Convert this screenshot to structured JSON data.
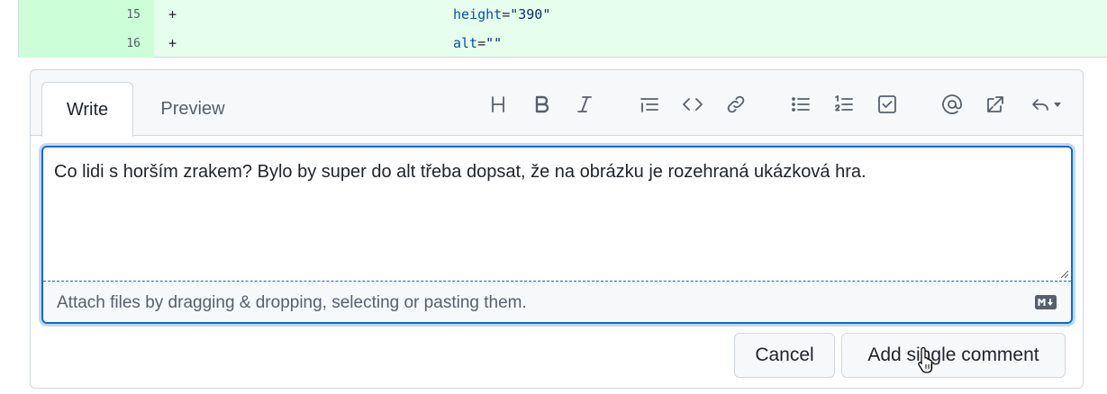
{
  "diff": {
    "lines": [
      {
        "number": "15",
        "sign": "+",
        "attr": "height",
        "eq": "=",
        "value": "\"390\""
      },
      {
        "number": "16",
        "sign": "+",
        "attr": "alt",
        "eq": "=",
        "value": "\"\""
      }
    ]
  },
  "comment": {
    "tabs": {
      "write": "Write",
      "preview": "Preview"
    },
    "toolbar": [
      {
        "icon": "heading-icon"
      },
      {
        "icon": "bold-icon"
      },
      {
        "icon": "italic-icon"
      },
      {
        "icon": "quote-icon"
      },
      {
        "icon": "code-icon"
      },
      {
        "icon": "link-icon"
      },
      {
        "icon": "bulleted-list-icon"
      },
      {
        "icon": "numbered-list-icon"
      },
      {
        "icon": "task-list-icon"
      },
      {
        "icon": "mention-icon"
      },
      {
        "icon": "cross-reference-icon"
      },
      {
        "icon": "reply-icon"
      }
    ],
    "text": "Co lidi s horším zrakem? Bylo by super do alt třeba dopsat, že na obrázku je rozehraná ukázková hra.",
    "attach_hint": "Attach files by dragging & dropping, selecting or pasting them.",
    "markdown_badge": "M↓",
    "buttons": {
      "cancel": "Cancel",
      "add": "Add single comment"
    }
  },
  "colors": {
    "diff_bg": "#e6ffec",
    "diff_num_bg": "#ccffd8",
    "focus_border": "#0969da"
  }
}
